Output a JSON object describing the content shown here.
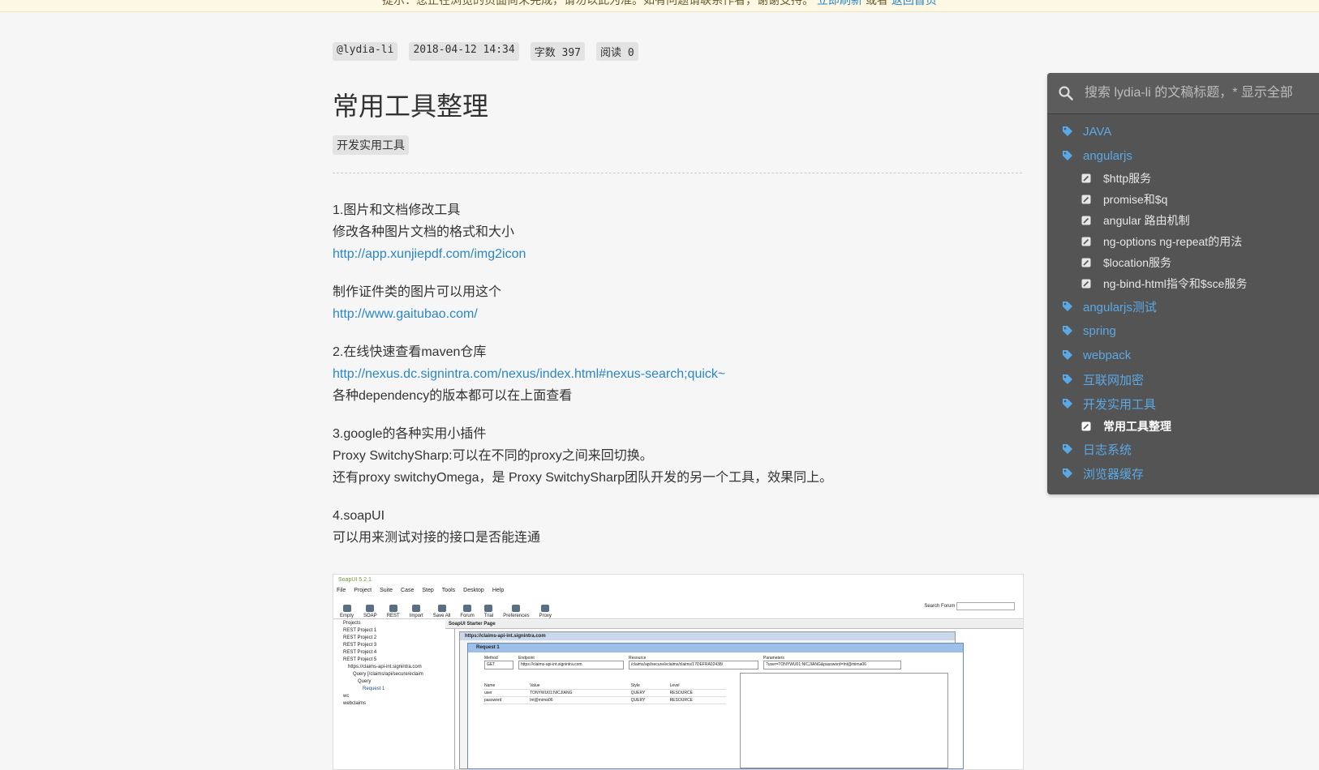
{
  "banner": {
    "text": "提示：您正在浏览的页面尚未完成，请勿以此为准。如有问题请联系作者，谢谢支持。",
    "link1": "立即刷新",
    "sep": "或者",
    "link2": "返回首页"
  },
  "meta": {
    "author": "@lydia-li",
    "date": "2018-04-12 14:34",
    "word_count": "字数 397",
    "reads": "阅读 0"
  },
  "article": {
    "title": "常用工具整理",
    "tag": "开发实用工具",
    "s1_heading": "1.图片和文档修改工具",
    "s1_desc": "修改各种图片文档的格式和大小",
    "s1_link": "http://app.xunjiepdf.com/img2icon",
    "s1b_desc": "制作证件类的图片可以用这个",
    "s1b_link": "http://www.gaitubao.com/",
    "s2_heading": "2.在线快速查看maven仓库",
    "s2_link": "http://nexus.dc.signintra.com/nexus/index.html#nexus-search;quick~",
    "s2_desc": "各种dependency的版本都可以在上面查看",
    "s3_heading": "3.google的各种实用小插件",
    "s3_line1": "Proxy SwitchySharp:可以在不同的proxy之间来回切换。",
    "s3_line2": "还有proxy switchyOmega，是 Proxy SwitchySharp团队开发的另一个工具，效果同上。",
    "s4_heading": "4.soapUI",
    "s4_desc": "可以用来测试对接的接口是否能连通"
  },
  "screenshot": {
    "app_title": "SoapUI 5.2.1",
    "menu": [
      "File",
      "Project",
      "Suite",
      "Case",
      "Step",
      "Tools",
      "Desktop",
      "Help"
    ],
    "toolbar": [
      "Empty",
      "SOAP",
      "REST",
      "Import",
      "Save All",
      "Forum",
      "Trial",
      "Preferences",
      "Proxy"
    ],
    "search_forum": "Search Forum",
    "navigator": [
      "Projects",
      "REST Project 1",
      "REST Project 2",
      "REST Project 3",
      "REST Project 4",
      "REST Project 5",
      "https://claims-api-int.signintra.com",
      "Query [/claims/api/secure/eclaim",
      "Query",
      "Request 1",
      "wc",
      "webclaims"
    ],
    "starter_tab": "SoapUI Starter Page",
    "inner_title": "https://claims-api-int.signintra.com",
    "request_title": "Request 1",
    "method_label": "Method",
    "method_value": "GET",
    "endpoint_label": "Endpoint",
    "endpoint_value": "https://claims-api-int.signintra.com",
    "resource_label": "Resource",
    "resource_value": "/claims/api/secure/eclaims/claims/17DEFRA02438/",
    "params_label": "Parameters",
    "params_value": "?user=TONYWU01:NICJIANG&password=Int@mima06",
    "table_headers": [
      "Name",
      "Value",
      "Style",
      "Level"
    ],
    "table_rows": [
      [
        "user",
        "TONYWU01:NICJIANG",
        "QUERY",
        "RESOURCE"
      ],
      [
        "password",
        "Int@mima06",
        "QUERY",
        "RESOURCE"
      ]
    ]
  },
  "sidebar": {
    "search_placeholder": "搜索 lydia-li 的文稿标题，* 显示全部",
    "notebooks": {
      "java": "JAVA",
      "angularjs": "angularjs",
      "angularjs_test": "angularjs测试",
      "spring": "spring",
      "webpack": "webpack",
      "internet_crypto": "互联网加密",
      "dev_tools": "开发实用工具",
      "log_system": "日志系统",
      "browser_cache": "浏览器缓存"
    },
    "angular_notes": [
      "$http服务",
      "promise和$q",
      "angular 路由机制",
      "ng-options ng-repeat的用法",
      "$location服务",
      "ng-bind-html指令和$sce服务"
    ],
    "devtools_notes": [
      "常用工具整理"
    ]
  },
  "colors": {
    "link": "#2a86c8",
    "sidebar_bg": "#545454",
    "notebook_blue": "#5aa9e6",
    "page_bg": "#f6f6f6"
  }
}
